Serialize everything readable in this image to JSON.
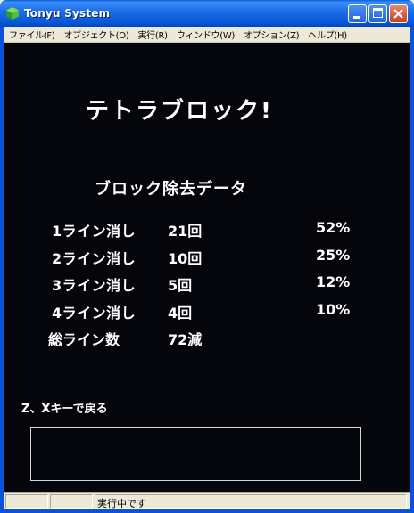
{
  "window": {
    "title": "Tonyu System",
    "icon": "cube-icon"
  },
  "menu": [
    {
      "label": "ファイル(F)"
    },
    {
      "label": "オブジェクト(O)"
    },
    {
      "label": "実行(R)"
    },
    {
      "label": "ウィンドウ(W)"
    },
    {
      "label": "オプション(Z)"
    },
    {
      "label": "ヘルプ(H)"
    }
  ],
  "game": {
    "title": "テトラブロック!",
    "subtitle": "ブロック除去データ",
    "rows": [
      {
        "label": "1ライン消し",
        "count": "21回",
        "percent": "52%"
      },
      {
        "label": "2ライン消し",
        "count": "10回",
        "percent": "25%"
      },
      {
        "label": "3ライン消し",
        "count": "5回",
        "percent": "12%"
      },
      {
        "label": "4ライン消し",
        "count": "4回",
        "percent": "10%"
      }
    ],
    "total": {
      "label": "総ライン数",
      "value": "72減"
    },
    "hint": "Z、Xキーで戻る"
  },
  "status": {
    "text": "実行中です"
  },
  "colors": {
    "titlebar": "#0a5fe0",
    "canvas": "#05060c",
    "text": "#ffffff",
    "chrome": "#ece9d8"
  }
}
